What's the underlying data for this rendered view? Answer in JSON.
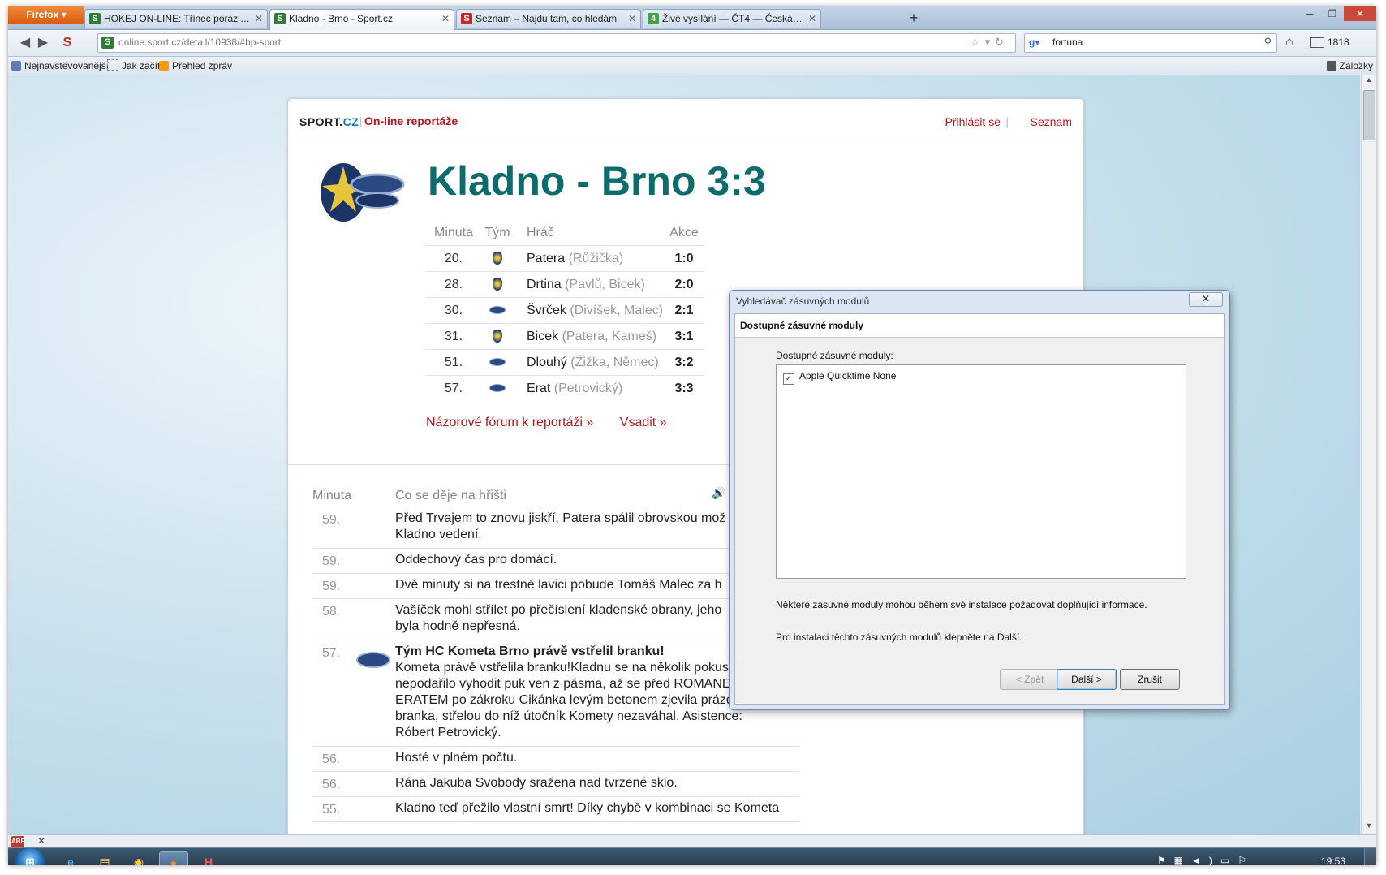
{
  "browser": {
    "menu_button": "Firefox ▾",
    "tabs": [
      {
        "label": "HOKEJ ON-LINE: Třinec porazil Zlín a ...",
        "favicon": "S",
        "color": "#2e7d32"
      },
      {
        "label": "Kladno - Brno - Sport.cz",
        "favicon": "S",
        "color": "#2e7d32"
      },
      {
        "label": "Seznam – Najdu tam, co hledám",
        "favicon": "S",
        "color": "#c62828"
      },
      {
        "label": "Živé vysílání — ČT4 — Česká televize",
        "favicon": "4",
        "color": "#43a047"
      }
    ],
    "new_tab": "+",
    "url": "online.sport.cz/detail/10938/#hp-sport",
    "search_text": "fortuna",
    "mail_count": "1818",
    "bookmarks": [
      "Nejnavštěvovanější",
      "Jak začít",
      "Přehled zpráv"
    ],
    "bookmarks_right": "Záložky"
  },
  "page": {
    "logo_main": "SPORT.",
    "logo_cz": "CZ",
    "section_title": "On-line reportáže",
    "login": "Přihlásit se",
    "seznam": "Seznam",
    "match_title": "Kladno - Brno 3:3",
    "goals_headers": {
      "minute": "Minuta",
      "team": "Tým",
      "player": "Hráč",
      "action": "Akce"
    },
    "goals": [
      {
        "minute": "20.",
        "team": "kladno",
        "player": "Patera",
        "assist": "(Růžička)",
        "score": "1:0"
      },
      {
        "minute": "28.",
        "team": "kladno",
        "player": "Drtina",
        "assist": "(Pavlů, Bicek)",
        "score": "2:0"
      },
      {
        "minute": "30.",
        "team": "kometa",
        "player": "Švrček",
        "assist": "(Divíšek, Malec)",
        "score": "2:1"
      },
      {
        "minute": "31.",
        "team": "kladno",
        "player": "Bicek",
        "assist": "(Patera, Kameš)",
        "score": "3:1"
      },
      {
        "minute": "51.",
        "team": "kometa",
        "player": "Dlouhý",
        "assist": "(Žižka, Němec)",
        "score": "3:2"
      },
      {
        "minute": "57.",
        "team": "kometa",
        "player": "Erat",
        "assist": "(Petrovický)",
        "score": "3:3"
      }
    ],
    "forum_link": "Názorové fórum k reportáži »",
    "bet_link": "Vsadit »",
    "feed_headers": {
      "minute": "Minuta",
      "title": "Co se děje na hřišti"
    },
    "feed": [
      {
        "minute": "59.",
        "text": "Před Trvajem to znovu jiskří, Patera spálil obrovskou mož",
        "text2": "Kladno vedení."
      },
      {
        "minute": "59.",
        "text": "Oddechový čas pro domácí."
      },
      {
        "minute": "59.",
        "text": "Dvě minuty si na trestné lavici pobude Tomáš Malec za h"
      },
      {
        "minute": "58.",
        "text": "Vašíček mohl střílet po přečíslení kladenské obrany, jeho",
        "text2": "byla hodně nepřesná."
      },
      {
        "minute": "57.",
        "goal_title": "Tým HC Kometa Brno právě vstřelil branku!",
        "text": "Kometa právě vstřelila branku!Kladnu se na několik pokusů nepodařilo vyhodit puk ven z pásma, až se před ROMANEM ERATEM po zákroku Cikánka levým betonem zjevila prázdná branka, střelou do níž útočník Komety nezaváhal. Asistence: Róbert Petrovický."
      },
      {
        "minute": "56.",
        "text": "Hosté v plném počtu."
      },
      {
        "minute": "56.",
        "text": "Rána Jakuba Svobody sražena nad tvrzené sklo."
      },
      {
        "minute": "55.",
        "text": "Kladno teď přežilo vlastní smrt! Díky chybě v kombinaci se Kometa"
      }
    ]
  },
  "dialog": {
    "title": "Vyhledávač zásuvných modulů",
    "heading": "Dostupné zásuvné moduly",
    "list_label": "Dostupné zásuvné moduly:",
    "plugin_name": "Apple Quicktime None",
    "plugin_checked": "✓",
    "info1": "Některé zásuvné moduly mohou během své instalace požadovat doplňující informace.",
    "info2": "Pro instalaci těchto zásuvných modulů klepněte na Další.",
    "back": "< Zpět",
    "next": "Další >",
    "cancel": "Zrušit"
  },
  "taskbar": {
    "clock": "19:53"
  },
  "colors": {
    "accent_red": "#b3161e",
    "title_teal": "#0c6b6b"
  }
}
